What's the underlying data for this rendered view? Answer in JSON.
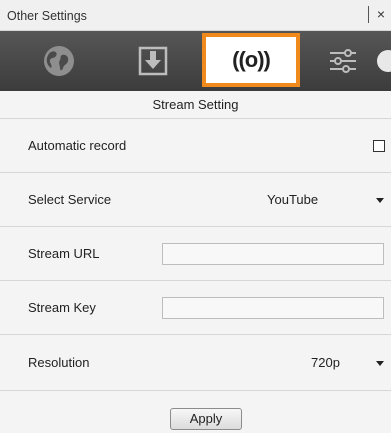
{
  "window": {
    "title": "Other Settings",
    "close_label": "×"
  },
  "toolbar": {
    "tabs": [
      {
        "icon": "globe-icon",
        "active": false
      },
      {
        "icon": "download-icon",
        "active": false
      },
      {
        "icon": "broadcast-icon",
        "glyph": "((o))",
        "active": true
      },
      {
        "icon": "sliders-icon",
        "active": false
      }
    ],
    "accent_color": "#f08a1d"
  },
  "section": {
    "title": "Stream Setting"
  },
  "settings": {
    "automatic_record": {
      "label": "Automatic record",
      "checked": false
    },
    "select_service": {
      "label": "Select Service",
      "value": "YouTube"
    },
    "stream_url": {
      "label": "Stream URL",
      "value": ""
    },
    "stream_key": {
      "label": "Stream Key",
      "value": ""
    },
    "resolution": {
      "label": "Resolution",
      "value": "720p"
    }
  },
  "actions": {
    "apply_label": "Apply"
  }
}
